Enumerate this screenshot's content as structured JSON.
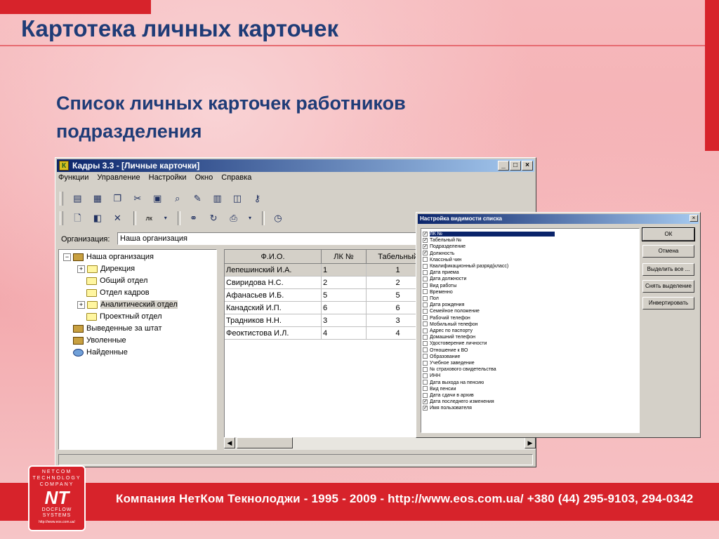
{
  "slide": {
    "title": "Картотека личных карточек",
    "subtitle_line1": "Список личных карточек работников",
    "subtitle_line2": "подразделения",
    "footer": "Компания НетКом Текнолоджи - 1995 - 2009 - http://www.eos.com.ua/ +380 (44) 295-9103, 294-0342",
    "logo": {
      "line1": "NETCOM",
      "line2": "TECHNOLOGY",
      "line3": "COMPANY",
      "mark": "NT",
      "line4": "DOCFLOW",
      "line5": "SYSTEMS",
      "url": "http://www.eos.com.ua/"
    }
  },
  "window": {
    "title": "Кадры 3.3 - [Личные карточки]",
    "menu": [
      "Функции",
      "Управление",
      "Настройки",
      "Окно",
      "Справка"
    ],
    "lk_label": "лк",
    "org_label": "Организация:",
    "org_value": "Наша организация",
    "tree": [
      {
        "label": "Наша организация"
      },
      {
        "label": "Дирекция"
      },
      {
        "label": "Общий отдел"
      },
      {
        "label": "Отдел кадров"
      },
      {
        "label": "Аналитический отдел"
      },
      {
        "label": "Проектный отдел"
      },
      {
        "label": "Выведенные за штат"
      },
      {
        "label": "Уволенные"
      },
      {
        "label": "Найденные"
      }
    ],
    "grid": {
      "columns": [
        "Ф.И.О.",
        "ЛК №",
        "Табельный"
      ],
      "rows": [
        [
          "Лепешинский И.А.",
          "1",
          "1"
        ],
        [
          "Свиридова Н.С.",
          "2",
          "2"
        ],
        [
          "Афанасьев И.Б.",
          "5",
          "5"
        ],
        [
          "Канадский И.П.",
          "6",
          "6"
        ],
        [
          "Традников Н.Н.",
          "3",
          "3"
        ],
        [
          "Феоктистова И.Л.",
          "4",
          "4"
        ]
      ]
    }
  },
  "dialog": {
    "title": "Настройка видимости списка",
    "items": [
      {
        "label": "ЛК №",
        "checked": true
      },
      {
        "label": "Табельный №",
        "checked": true
      },
      {
        "label": "Подразделение",
        "checked": true
      },
      {
        "label": "Должность",
        "checked": true
      },
      {
        "label": "Классный чин",
        "checked": false
      },
      {
        "label": "Квалификационный разряд(класс)",
        "checked": false
      },
      {
        "label": "Дата приема",
        "checked": false
      },
      {
        "label": "Дата должности",
        "checked": false
      },
      {
        "label": "Вид работы",
        "checked": false
      },
      {
        "label": "Временно",
        "checked": false
      },
      {
        "label": "Пол",
        "checked": false
      },
      {
        "label": "Дата рождения",
        "checked": false
      },
      {
        "label": "Семейное положение",
        "checked": false
      },
      {
        "label": "Рабочий телефон",
        "checked": false
      },
      {
        "label": "Мобильный телефон",
        "checked": false
      },
      {
        "label": "Адрес по паспорту",
        "checked": false
      },
      {
        "label": "Домашний телефон",
        "checked": false
      },
      {
        "label": "Удостоверение личности",
        "checked": false
      },
      {
        "label": "Отношение к ВО",
        "checked": false
      },
      {
        "label": "Образование",
        "checked": false
      },
      {
        "label": "Учебное заведение",
        "checked": false
      },
      {
        "label": "№ страхового свидетельства",
        "checked": false
      },
      {
        "label": "ИНН",
        "checked": false
      },
      {
        "label": "Дата выхода на пенсию",
        "checked": false
      },
      {
        "label": "Вид пенсии",
        "checked": false
      },
      {
        "label": "Дата сдачи в архив",
        "checked": false
      },
      {
        "label": "Дата последнего изменения",
        "checked": true
      },
      {
        "label": "Имя пользователя",
        "checked": true
      }
    ],
    "buttons": {
      "ok": "ОК",
      "cancel": "Отмена",
      "select_all": "Выделить все ...",
      "deselect": "Снять выделение",
      "invert": "Инвертировать"
    }
  }
}
